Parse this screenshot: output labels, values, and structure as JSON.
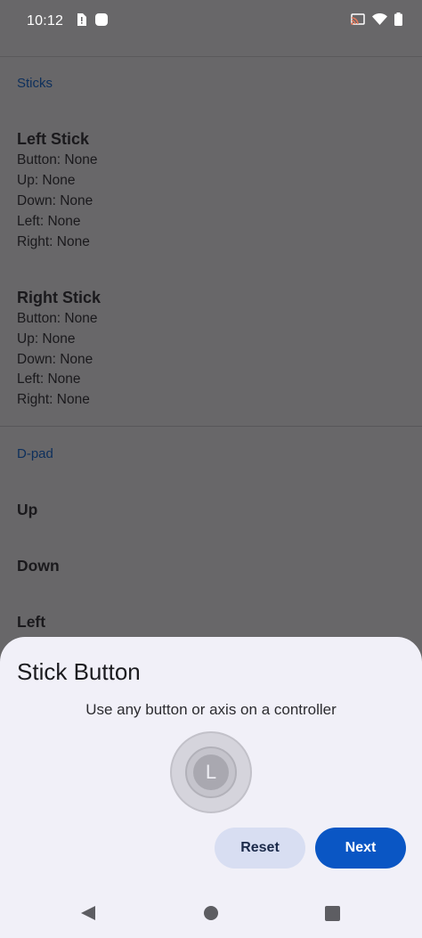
{
  "status_bar": {
    "time": "10:12",
    "icons": [
      "notification-sim-icon",
      "notification-dot-icon",
      "cast-icon",
      "wifi-icon",
      "battery-icon"
    ]
  },
  "sections": {
    "sticks_header": "Sticks",
    "left_stick": {
      "title": "Left Stick",
      "lines": [
        "Button: None",
        "Up: None",
        "Down: None",
        "Left: None",
        "Right: None"
      ]
    },
    "right_stick": {
      "title": "Right Stick",
      "lines": [
        "Button: None",
        "Up: None",
        "Down: None",
        "Left: None",
        "Right: None"
      ]
    },
    "dpad_header": "D-pad",
    "dpad_items": [
      "Up",
      "Down",
      "Left"
    ]
  },
  "dialog": {
    "title": "Stick Button",
    "subtitle": "Use any button or axis on a controller",
    "stick_label": "L",
    "reset_label": "Reset",
    "next_label": "Next"
  },
  "colors": {
    "scrim_bg": "#686769",
    "sheet_bg": "#f1f0f8",
    "accent": "#0a56c4",
    "reset_bg": "#d8def2"
  }
}
